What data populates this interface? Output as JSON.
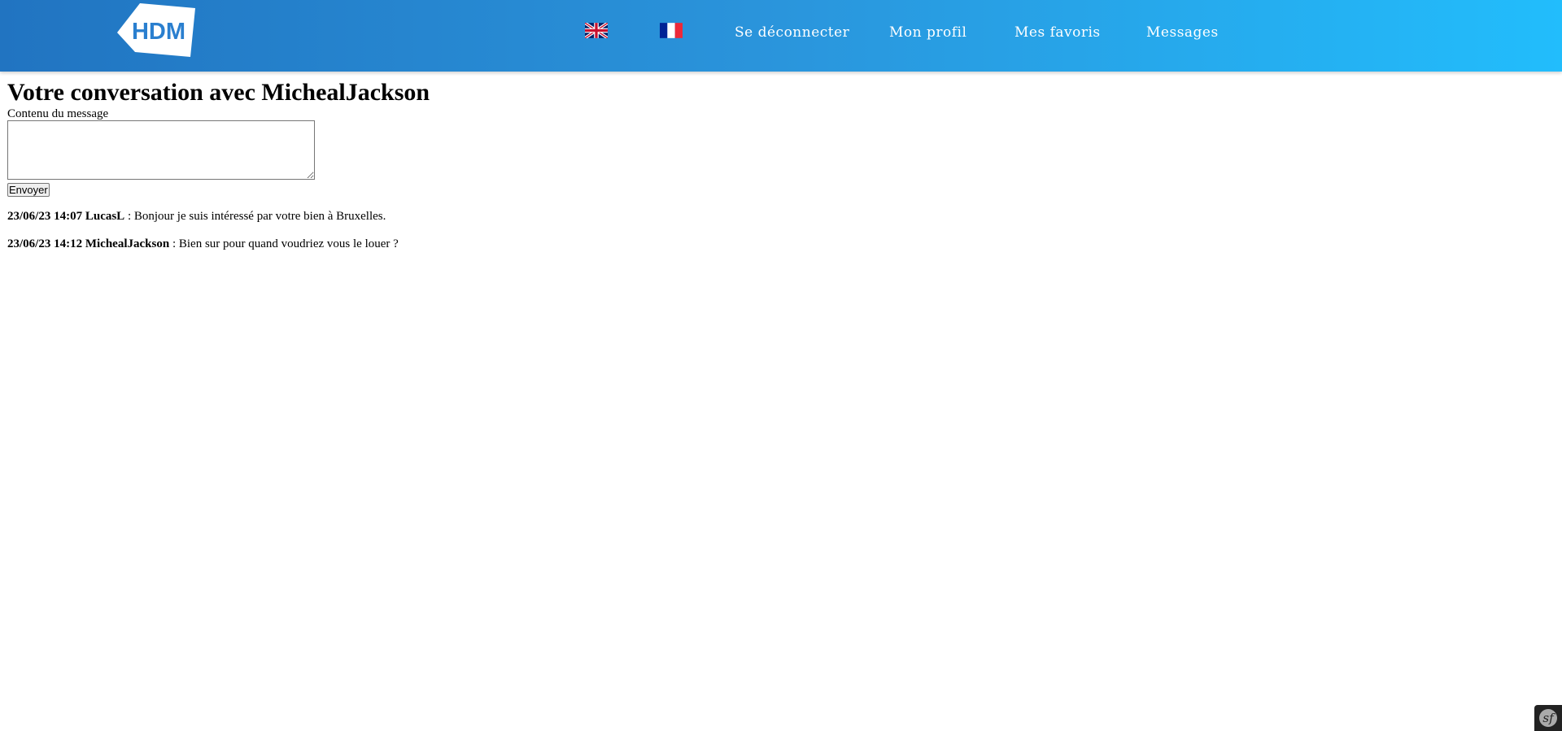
{
  "navbar": {
    "logo_text": "HDM",
    "languages": [
      {
        "code": "en",
        "icon": "uk-flag-icon"
      },
      {
        "code": "fr",
        "icon": "french-flag-icon"
      }
    ],
    "links": {
      "logout": "Se déconnecter",
      "profile": "Mon profil",
      "favorites": "Mes favoris",
      "messages": "Messages"
    },
    "colors": {
      "gradient_start": "#2174c1",
      "gradient_end": "#22bdfc"
    }
  },
  "page": {
    "title": "Votre conversation avec MichealJackson"
  },
  "form": {
    "label": "Contenu du message",
    "textarea_value": "",
    "submit_label": "Envoyer"
  },
  "messages": [
    {
      "timestamp": "23/06/23 14:07",
      "author": "LucasL",
      "separator": " : ",
      "text": "Bonjour je suis intéressé par votre bien à Bruxelles."
    },
    {
      "timestamp": "23/06/23 14:12",
      "author": "MichealJackson",
      "separator": " : ",
      "text": "Bien sur pour quand voudriez vous le louer ?"
    }
  ],
  "debug_toolbar": {
    "icon": "symfony-icon"
  }
}
